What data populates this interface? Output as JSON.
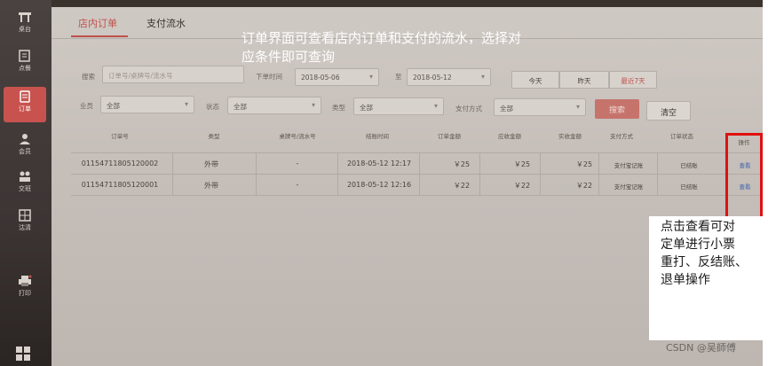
{
  "sidebar": {
    "items": [
      {
        "label": "桌台",
        "icon": "table-icon"
      },
      {
        "label": "点餐",
        "icon": "order-edit-icon"
      },
      {
        "label": "订单",
        "icon": "order-list-icon",
        "active": true
      },
      {
        "label": "会员",
        "icon": "member-icon"
      },
      {
        "label": "交班",
        "icon": "handover-icon"
      },
      {
        "label": "沽清",
        "icon": "grid-icon"
      },
      {
        "label": "打印",
        "icon": "printer-icon"
      }
    ],
    "bottom_icon": "apps-grid-icon"
  },
  "tabs": [
    {
      "label": "店内订单",
      "active": true
    },
    {
      "label": "支付流水",
      "active": false
    }
  ],
  "filters": {
    "search_label": "搜索",
    "search_placeholder": "订单号/桌牌号/流水号",
    "time_label": "下单时间",
    "date_from": "2018-05-06",
    "to_label": "至",
    "date_to": "2018-05-12",
    "quick_ranges": [
      "今天",
      "昨天",
      "最近7天"
    ],
    "staff_label": "业员",
    "staff_value": "全部",
    "status_label": "状态",
    "status_value": "全部",
    "type_label": "类型",
    "type_value": "全部",
    "pay_label": "支付方式",
    "pay_value": "全部",
    "search_button": "搜索",
    "clear_button": "清空"
  },
  "table": {
    "headers": [
      "订单号",
      "类型",
      "桌牌号/流水号",
      "结账时间",
      "订单金额",
      "应收金额",
      "实收金额",
      "支付方式",
      "订单状态",
      "操作"
    ],
    "rows": [
      [
        "01154711805120002",
        "外带",
        "-",
        "2018-05-12 12:17",
        "￥25",
        "￥25",
        "￥25",
        "支付宝记账",
        "已结账",
        "查看"
      ],
      [
        "01154711805120001",
        "外带",
        "-",
        "2018-05-12 12:16",
        "￥22",
        "￥22",
        "￥22",
        "支付宝记账",
        "已结账",
        "查看"
      ]
    ]
  },
  "annotations": {
    "top_line1": "订单界面可查看店内订单和支付的流水，选择对",
    "top_line2": "应条件即可查询",
    "right_lines": [
      "点击查看可对",
      "定单进行小票",
      "重打、反结账、",
      "退单操作"
    ],
    "watermark": "CSDN @吴師傅",
    "highlight_color": "#e01010"
  }
}
